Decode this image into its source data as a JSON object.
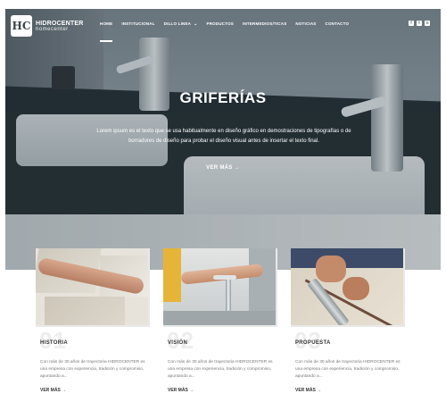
{
  "header": {
    "logo_mark": "HC",
    "logo_name": "HIDROCENTER",
    "logo_sub": "homecenter",
    "nav": [
      {
        "label": "HOME",
        "active": true
      },
      {
        "label": "INSTITUCIONAL",
        "active": false
      },
      {
        "label": "DILLO LINEA",
        "active": false,
        "dropdown": true
      },
      {
        "label": "PRODUCTOS",
        "active": false
      },
      {
        "label": "INTERMEDIOS/TICAS",
        "active": false
      },
      {
        "label": "NOTICIAS",
        "active": false
      },
      {
        "label": "CONTACTO",
        "active": false
      }
    ],
    "social_icons": [
      "facebook-icon",
      "twitter-icon",
      "instagram-icon"
    ]
  },
  "hero": {
    "title": "GRIFERÍAS",
    "text": "Lorem ipsum es el texto que se usa habitualmente en diseño gráfico en demostraciones de tipografías o de borradores de diseño para probar el diseño visual antes de insertar el texto final.",
    "button": "VER MÁS →"
  },
  "cards": [
    {
      "number": "01",
      "label": "HISTORIA",
      "text": "Con más de 30 años de trayectoria HIDROCENTER es una empresa con experiencia, tradición y compromiso, apuntando a...",
      "more": "VER MÁS →"
    },
    {
      "number": "02",
      "label": "VISIÓN",
      "text": "Con más de 30 años de trayectoria HIDROCENTER es una empresa con experiencia, tradición y compromiso, apuntando a...",
      "more": "VER MÁS →"
    },
    {
      "number": "03",
      "label": "PROPUESTA",
      "text": "Con más de 30 años de trayectoria HIDROCENTER es una empresa con experiencia, tradición y compromiso, apuntando a...",
      "more": "VER MÁS →"
    }
  ]
}
